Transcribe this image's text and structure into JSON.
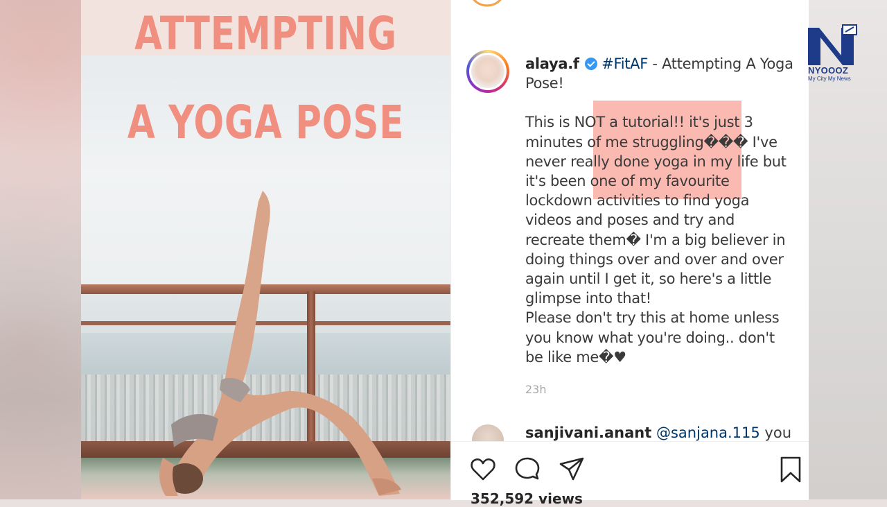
{
  "image_overlay": {
    "line1": "ATTEMPTING",
    "line2": "A YOGA POSE"
  },
  "post": {
    "username": "alaya.f",
    "hashtag": "#FitAF",
    "title_rest": " - Attempting A Yoga Pose!",
    "caption_paragraph1": "This is NOT a tutorial!! it's just 3 minutes of me struggling��� I've never really done yoga in my life but it's been one of my favourite lockdown activities to find yoga videos and poses and try and recreate them� I'm a big believer in doing things over and over and over again until I get it, so here's a little glimpse into that!",
    "caption_paragraph2": "Please don't try this at home unless you know what you're doing.. don't be like me�♥",
    "timestamp": "23h",
    "views": "352,592 views"
  },
  "comment": {
    "username": "sanjivani.anant",
    "mention": "@sanjana.115",
    "text": " you"
  },
  "actions": {
    "like_icon": "heart-icon",
    "comment_icon": "comment-icon",
    "share_icon": "share-icon",
    "save_icon": "bookmark-icon"
  },
  "logo": {
    "brand": "NYOOOZ",
    "tagline": "My City My News"
  },
  "colors": {
    "overlay_text": "#f08f7f",
    "verified_badge": "#3897f0",
    "highlight": "#f58273"
  }
}
